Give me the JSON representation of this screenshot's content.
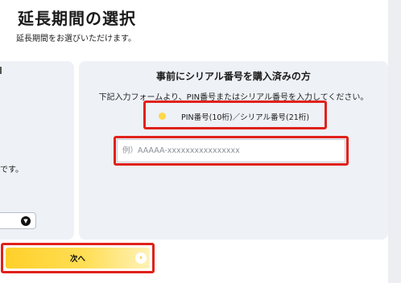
{
  "header": {
    "title": "延長期間の選択",
    "subtitle": "延長期間をお選びいただけます。"
  },
  "left_panel": {
    "text": "です。",
    "select_icon": "chevron-down-icon"
  },
  "serial_panel": {
    "heading": "事前にシリアル番号を購入済みの方",
    "description": "下記入力フォームより、PIN番号またはシリアル番号を入力してください。",
    "radio_label": "PIN番号(10桁)／シリアル番号(21桁)",
    "input_placeholder": "例）AAAAA-xxxxxxxxxxxxxxxx",
    "input_value": ""
  },
  "next_button": {
    "label": "次へ",
    "icon": "chevron-right-icon"
  },
  "colors": {
    "highlight": "#e0211a",
    "accent_yellow": "#ffd02a",
    "panel_bg": "#eef1f6"
  }
}
